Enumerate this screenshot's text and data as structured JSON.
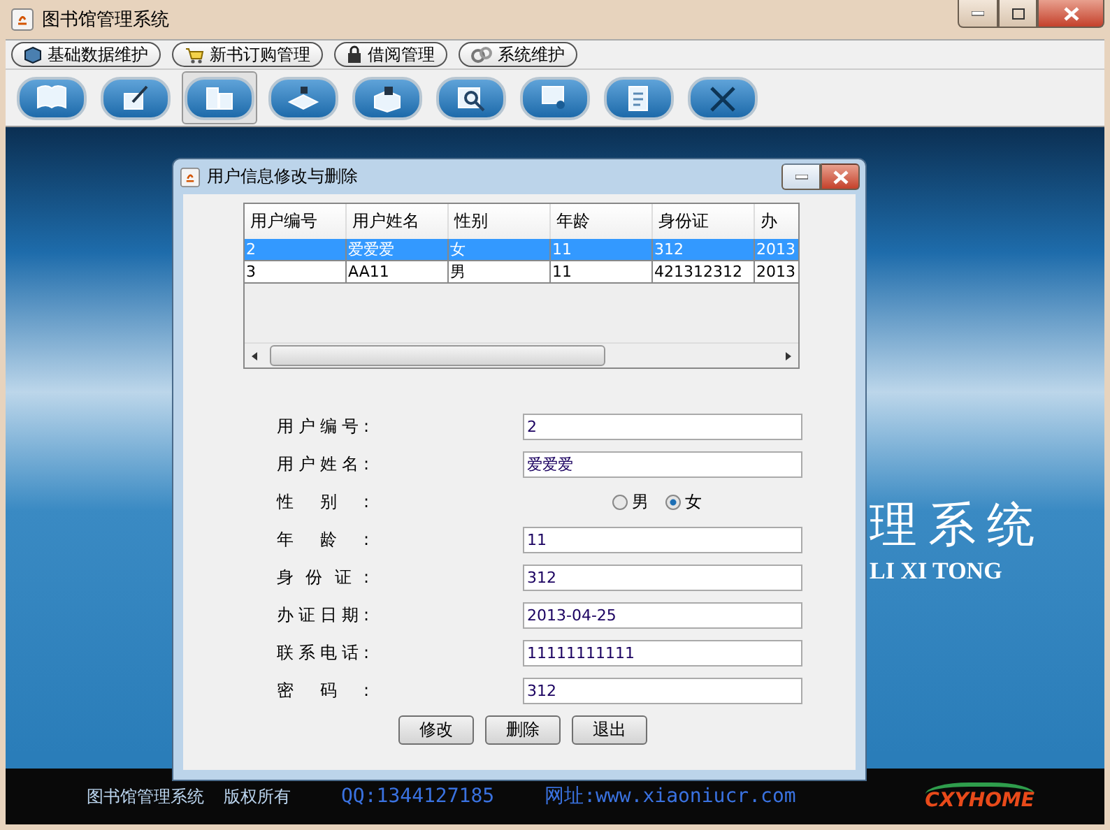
{
  "window": {
    "title": "图书馆管理系统"
  },
  "menu": [
    {
      "label": "基础数据维护"
    },
    {
      "label": "新书订购管理"
    },
    {
      "label": "借阅管理"
    },
    {
      "label": "系统维护"
    }
  ],
  "toolbar": [
    {
      "selected": false
    },
    {
      "selected": false
    },
    {
      "selected": true
    },
    {
      "selected": false
    },
    {
      "selected": false
    },
    {
      "selected": false
    },
    {
      "selected": false
    },
    {
      "selected": false
    },
    {
      "selected": false
    }
  ],
  "banner": {
    "title": "理系统",
    "subtitle": "LI XI TONG"
  },
  "footer": {
    "name": "图书馆管理系统",
    "copyright": "版权所有",
    "qq": "QQ:1344127185",
    "website": "网址:www.xiaoniucr.com",
    "logo": "CXYHOME"
  },
  "dialog": {
    "title": "用户信息修改与删除",
    "table": {
      "columns": [
        "用户编号",
        "用户姓名",
        "性别",
        "年龄",
        "身份证",
        "办"
      ],
      "rows": [
        {
          "cells": [
            "2",
            "爱爱爱",
            "女",
            "11",
            "312",
            "2013"
          ],
          "selected": true
        },
        {
          "cells": [
            "3",
            "AA11",
            "男",
            "11",
            "421312312",
            "2013"
          ],
          "selected": false
        }
      ]
    },
    "form": [
      {
        "kind": "text",
        "label": "用户编号:",
        "value": "2"
      },
      {
        "kind": "text",
        "label": "用户姓名:",
        "value": "爱爱爱"
      },
      {
        "kind": "radio",
        "label": "性别:",
        "options": [
          {
            "label": "男",
            "selected": false
          },
          {
            "label": "女",
            "selected": true
          }
        ]
      },
      {
        "kind": "text",
        "label": "年龄:",
        "value": "11"
      },
      {
        "kind": "text",
        "label": "身份证:",
        "value": "312"
      },
      {
        "kind": "text",
        "label": "办证日期:",
        "value": "2013-04-25"
      },
      {
        "kind": "text",
        "label": "联系电话:",
        "value": "11111111111"
      },
      {
        "kind": "text",
        "label": "密码:",
        "value": "312"
      }
    ],
    "buttons": [
      "修改",
      "删除",
      "退出"
    ]
  }
}
